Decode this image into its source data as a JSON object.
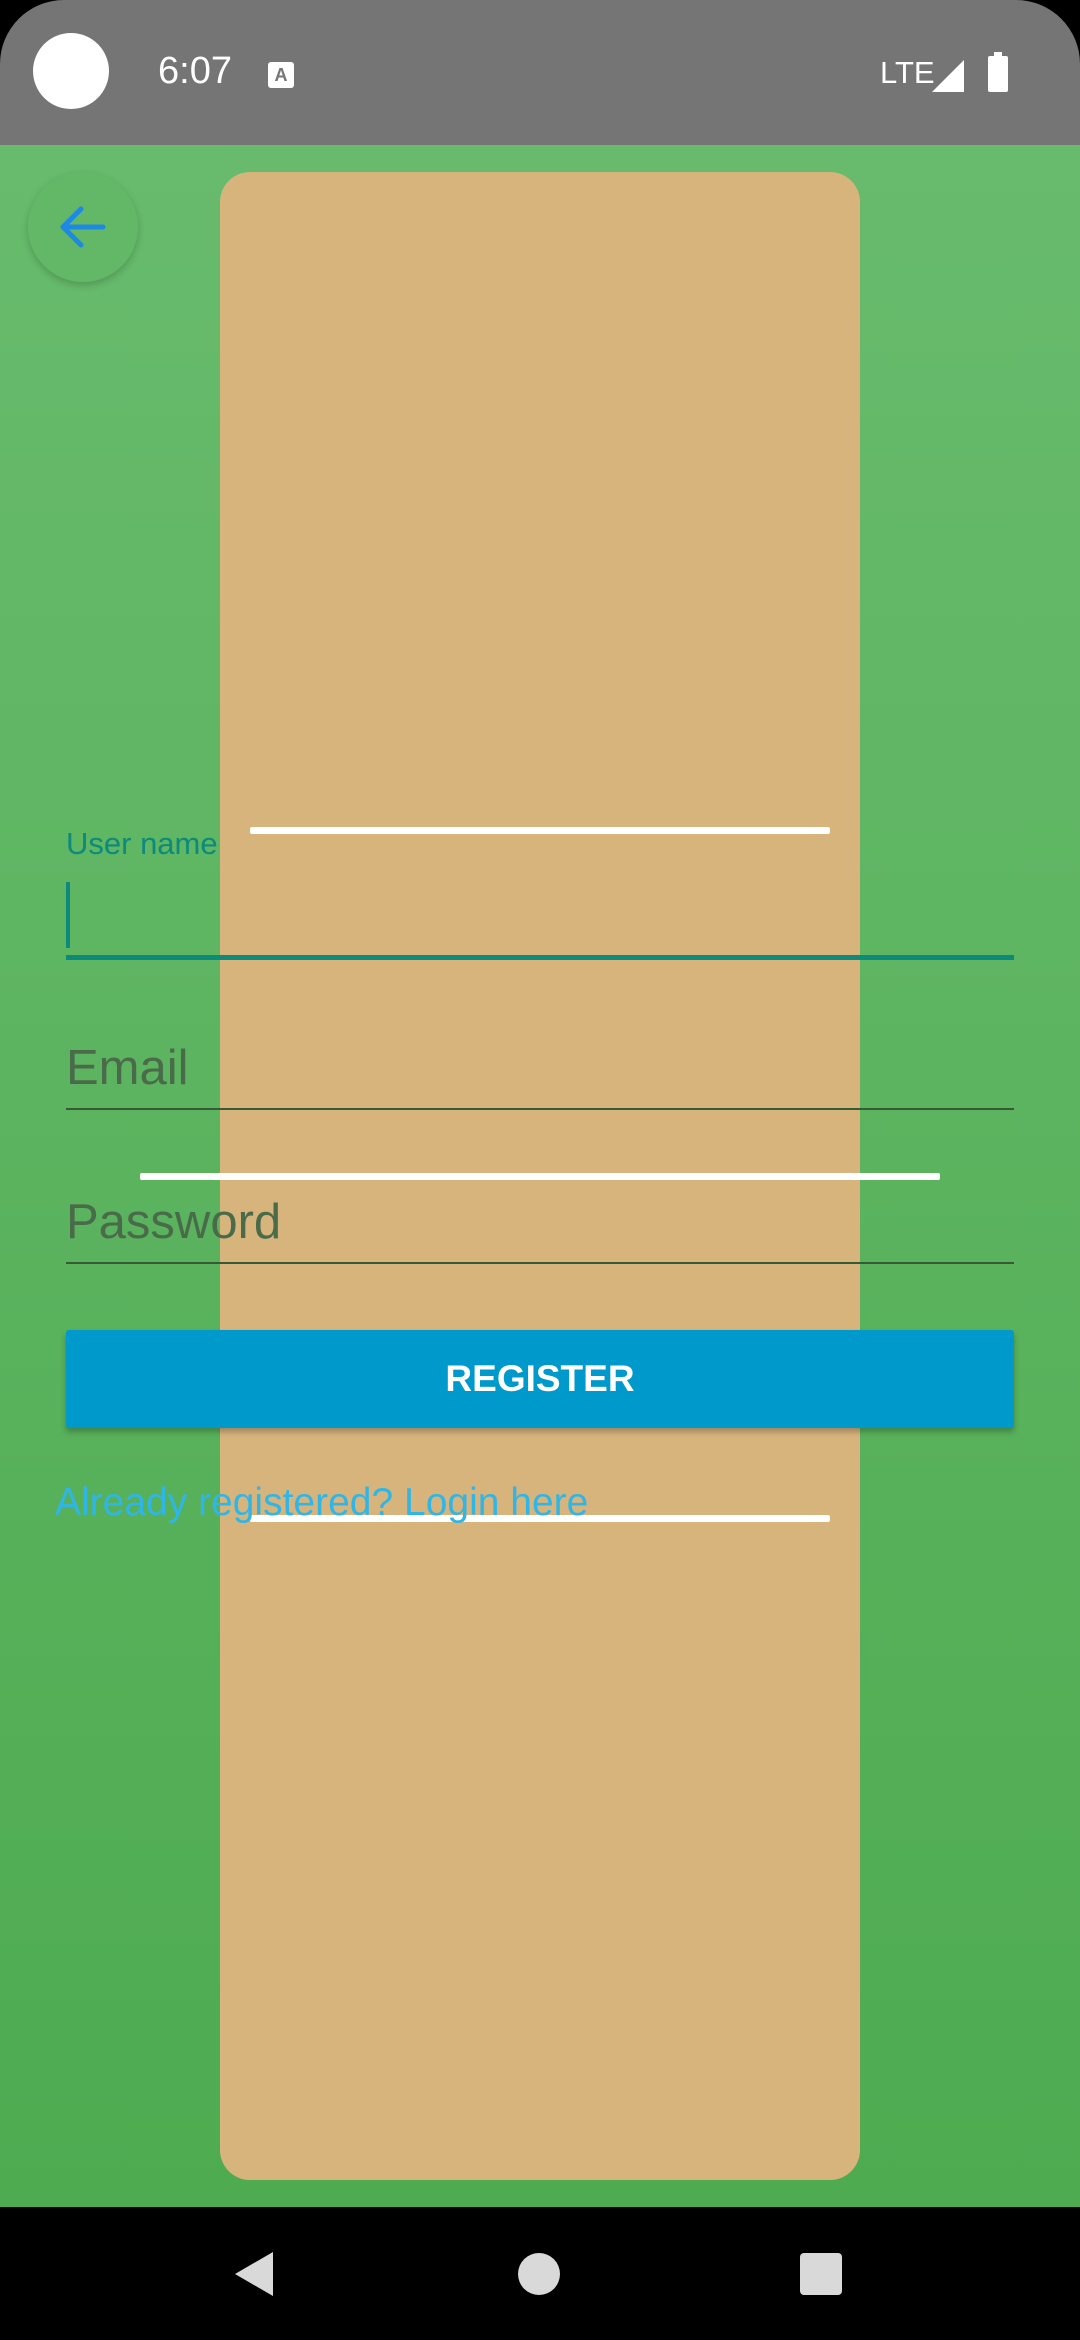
{
  "status_bar": {
    "time": "6:07",
    "network": "LTE",
    "notification_icon": "A"
  },
  "form": {
    "username_label": "User name",
    "email_placeholder": "Email",
    "password_placeholder": "Password",
    "register_label": "REGISTER",
    "login_link": "Already registered? Login here"
  },
  "icons": {
    "back": "arrow-back-icon",
    "signal": "signal-icon",
    "battery": "battery-icon",
    "nav_back": "nav-back-icon",
    "nav_home": "nav-home-icon",
    "nav_recents": "nav-recents-icon"
  },
  "colors": {
    "status_bar": "#757575",
    "background_top": "#68bb6d",
    "background_bottom": "#4eab50",
    "card": "#d8b47d",
    "accent": "#0e8a7c",
    "button": "#0099cc",
    "link": "#30b6e6",
    "back_arrow": "#1e88e5"
  }
}
